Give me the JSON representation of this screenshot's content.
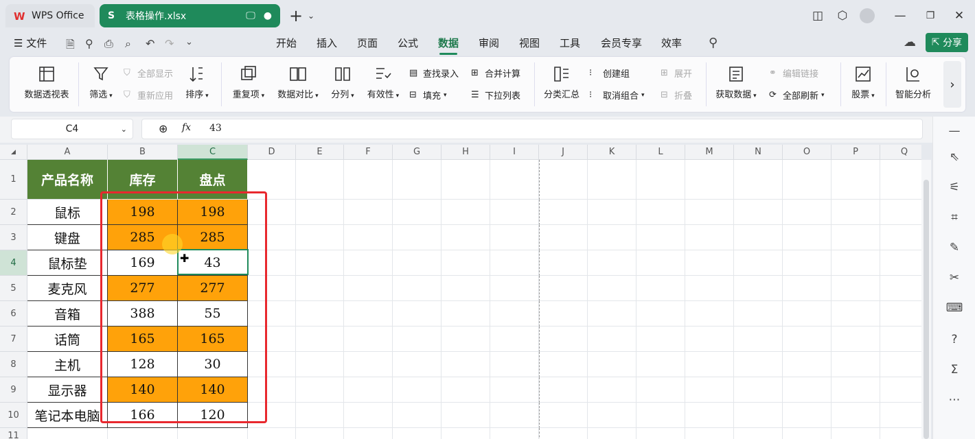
{
  "tabs": {
    "home": "WPS Office",
    "file": "表格操作.xlsx"
  },
  "menu": {
    "file": "文件",
    "items": [
      "开始",
      "插入",
      "页面",
      "公式",
      "数据",
      "审阅",
      "视图",
      "工具",
      "会员专享",
      "效率"
    ],
    "active": "数据",
    "share": "分享"
  },
  "ribbon": {
    "pivot": "数据透视表",
    "filter": "筛选",
    "show_all": "全部显示",
    "reapply": "重新应用",
    "sort": "排序",
    "dup": "重复项",
    "compare": "数据对比",
    "split": "分列",
    "validity": "有效性",
    "find_entry": "查找录入",
    "fill": "填充",
    "merge_calc": "合并计算",
    "dropdown_list": "下拉列表",
    "subtotal": "分类汇总",
    "group": "创建组",
    "ungroup": "取消组合",
    "expand": "展开",
    "collapse": "折叠",
    "get_data": "获取数据",
    "edit_links": "编辑链接",
    "refresh_all": "全部刷新",
    "stocks": "股票",
    "smart": "智能分析"
  },
  "formula_bar": {
    "name_box": "C4",
    "fx": "fx",
    "value": "43"
  },
  "columns": [
    "A",
    "B",
    "C",
    "D",
    "E",
    "F",
    "G",
    "H",
    "I",
    "J",
    "K",
    "L",
    "M",
    "N",
    "O",
    "P",
    "Q"
  ],
  "rows": [
    "1",
    "2",
    "3",
    "4",
    "5",
    "6",
    "7",
    "8",
    "9",
    "10",
    "11"
  ],
  "table": {
    "headers": [
      "产品名称",
      "库存",
      "盘点"
    ],
    "data": [
      {
        "name": "鼠标",
        "stock": "198",
        "count": "198",
        "hl": true
      },
      {
        "name": "键盘",
        "stock": "285",
        "count": "285",
        "hl": true
      },
      {
        "name": "鼠标垫",
        "stock": "169",
        "count": "43",
        "hl": false
      },
      {
        "name": "麦克风",
        "stock": "277",
        "count": "277",
        "hl": true
      },
      {
        "name": "音箱",
        "stock": "388",
        "count": "55",
        "hl": false
      },
      {
        "name": "话筒",
        "stock": "165",
        "count": "165",
        "hl": true
      },
      {
        "name": "主机",
        "stock": "128",
        "count": "30",
        "hl": false
      },
      {
        "name": "显示器",
        "stock": "140",
        "count": "140",
        "hl": true
      },
      {
        "name": "笔记本电脑",
        "stock": "166",
        "count": "120",
        "hl": false
      }
    ]
  },
  "colors": {
    "accent": "#1f8a5b",
    "header_fill": "#548235",
    "highlight": "#ffa20a",
    "annotation": "#e8282e"
  }
}
